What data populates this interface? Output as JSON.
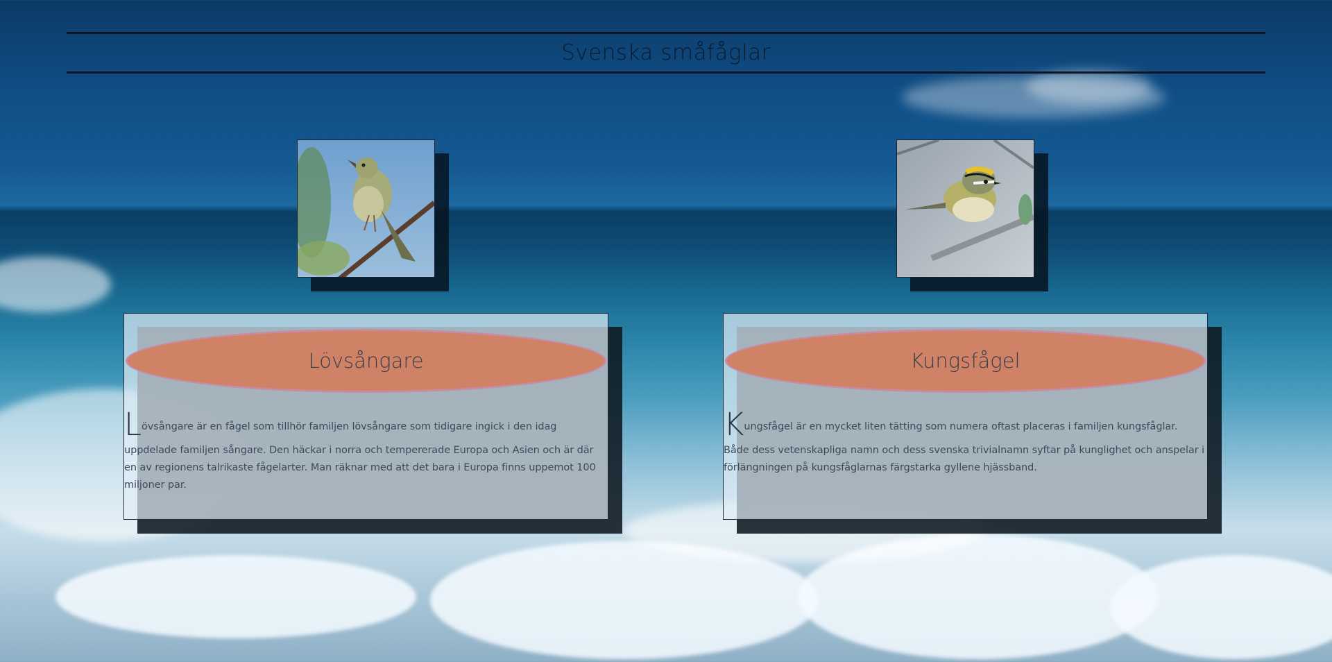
{
  "page": {
    "title": "Svenska småfåglar"
  },
  "birds": [
    {
      "name": "Lövsångare",
      "dropcap": "L",
      "lead_text": "övsångare är en fågel som tillhör familjen lövsångare som tidigare ingick i den idag",
      "body_text": "uppdelade familjen sångare. Den häckar i norra och tempererade Europa och Asien och är där en av regionens talrikaste fågelarter. Man räknar med att det bara i Europa finns uppemot 100 miljoner par."
    },
    {
      "name": "Kungsfågel",
      "dropcap": "K",
      "lead_text": "ungsfågel är en mycket liten tätting som numera oftast placeras i familjen kungsfåglar.",
      "body_text": "Både dess vetenskapliga namn och dess svenska trivialnamn syftar på kunglighet och anspelar i förlängningen på kungsfåglarnas färgstarka gyllene hjässband."
    }
  ],
  "colors": {
    "pill_fill": "#cf8266",
    "pill_border": "#c98ba2",
    "header_rule": "#0b1420",
    "card_shadow": "#0e1820"
  }
}
